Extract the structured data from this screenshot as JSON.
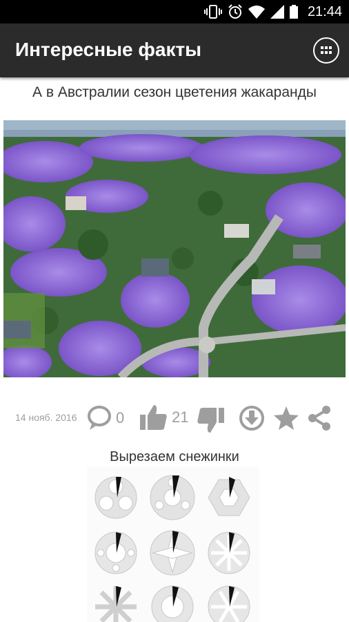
{
  "status_bar": {
    "time": "21:44",
    "icons": [
      "vibrate-icon",
      "alarm-icon",
      "wifi-icon",
      "signal-icon",
      "battery-icon"
    ]
  },
  "app_bar": {
    "title": "Интересные факты",
    "menu_icon": "apps-grid-icon"
  },
  "post": {
    "title": "А в Австралии сезон цветения жакаранды",
    "image": "aerial-jacaranda-photo",
    "date": "14 нояб. 2016",
    "comments": "0",
    "likes": "21",
    "actions": [
      "comment-icon",
      "like-icon",
      "dislike-icon",
      "download-icon",
      "star-icon",
      "share-icon"
    ]
  },
  "next_post": {
    "title": "Вырезаем снежинки",
    "image": "snowflake-cutting-diagram"
  },
  "colors": {
    "app_bar": "#2b2b2b",
    "icon_gray": "#9e9e9e",
    "text": "#333333",
    "jacaranda": "#8e6ad8"
  }
}
